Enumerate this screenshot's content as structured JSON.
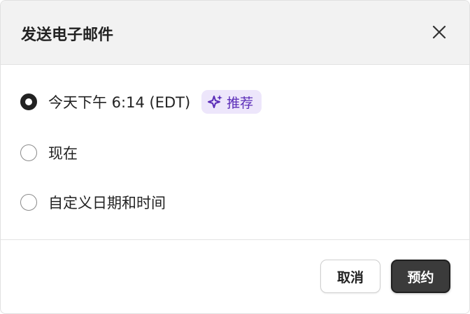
{
  "dialog": {
    "title": "发送电子邮件",
    "close_icon": "close-icon"
  },
  "options": [
    {
      "label": "今天下午 6:14 (EDT)",
      "selected": true,
      "badge": {
        "icon": "sparkle-icon",
        "text": "推荐"
      }
    },
    {
      "label": "现在",
      "selected": false
    },
    {
      "label": "自定义日期和时间",
      "selected": false
    }
  ],
  "footer": {
    "cancel_label": "取消",
    "schedule_label": "预约"
  },
  "colors": {
    "header_bg": "#f2f2f2",
    "badge_bg": "#ede6fb",
    "badge_text": "#5b2db8",
    "primary_button": "#3b3b3b"
  }
}
